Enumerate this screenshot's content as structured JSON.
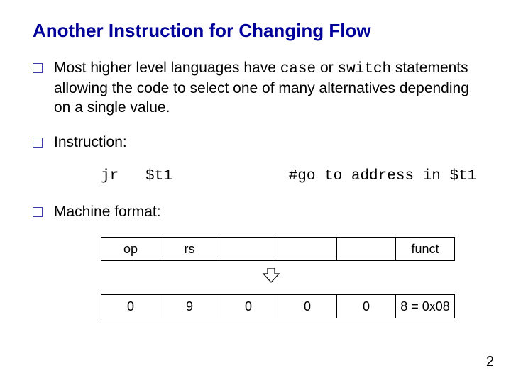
{
  "title": "Another Instruction for Changing Flow",
  "bullets": {
    "b1": {
      "t1": "Most higher level languages have ",
      "code1": "case",
      "t2": " or ",
      "code2": "switch",
      "t3": " statements allowing the code to select one of many alternatives depending on a single value."
    },
    "b2": "Instruction:",
    "b3": "Machine format:"
  },
  "code": {
    "line": "jr   $t1             #go to address in $t1"
  },
  "table_fields": {
    "c0": "op",
    "c1": "rs",
    "c2": "",
    "c3": "",
    "c4": "",
    "c5": "funct"
  },
  "table_values": {
    "c0": "0",
    "c1": "9",
    "c2": "0",
    "c3": "0",
    "c4": "0",
    "c5": "8 = 0x08"
  },
  "page_number": "2"
}
